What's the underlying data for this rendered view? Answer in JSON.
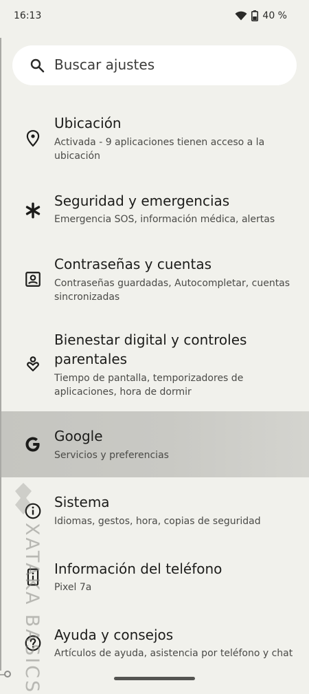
{
  "status": {
    "time": "16:13",
    "battery": "40 %",
    "icons": [
      "wifi-icon",
      "battery-icon"
    ]
  },
  "search": {
    "placeholder": "Buscar ajustes",
    "icon": "search-icon"
  },
  "settings": {
    "items": [
      {
        "icon": "location-pin-icon",
        "title": "Ubicación",
        "subtitle_line1": "Activada - 9 aplicaciones tienen acceso a la",
        "subtitle_line2": "ubicación"
      },
      {
        "icon": "asterisk-icon",
        "title": "Seguridad y emergencias",
        "subtitle_line1": "Emergencia SOS, información médica, alertas"
      },
      {
        "icon": "account-box-icon",
        "title": "Contraseñas y cuentas",
        "subtitle_line1": "Contraseñas guardadas, Autocompletar, cuentas",
        "subtitle_line2": "sincronizadas"
      },
      {
        "icon": "wellbeing-icon",
        "title_line1": "Bienestar digital y controles",
        "title_line2": "parentales",
        "subtitle_line1": "Tiempo de pantalla, temporizadores de",
        "subtitle_line2": "aplicaciones, hora de dormir"
      },
      {
        "icon": "google-g-icon",
        "title": "Google",
        "subtitle_line1": "Servicios y preferencias",
        "highlighted": true
      },
      {
        "icon": "info-icon",
        "title": "Sistema",
        "subtitle_line1": "Idiomas, gestos, hora, copias de seguridad"
      },
      {
        "icon": "phone-info-icon",
        "title": "Información del teléfono",
        "subtitle_line1": "Pixel 7a"
      },
      {
        "icon": "help-icon",
        "title": "Ayuda y consejos",
        "subtitle_line1": "Artículos de ayuda, asistencia por teléfono y chat"
      }
    ]
  },
  "watermark": {
    "text": "XATAKA BASICS"
  },
  "colors": {
    "background": "#f1f1ec",
    "search_bg": "#ffffff",
    "highlight": "#c9c9c4",
    "text_primary": "#1c1c1a",
    "text_secondary": "#4a4a47"
  }
}
